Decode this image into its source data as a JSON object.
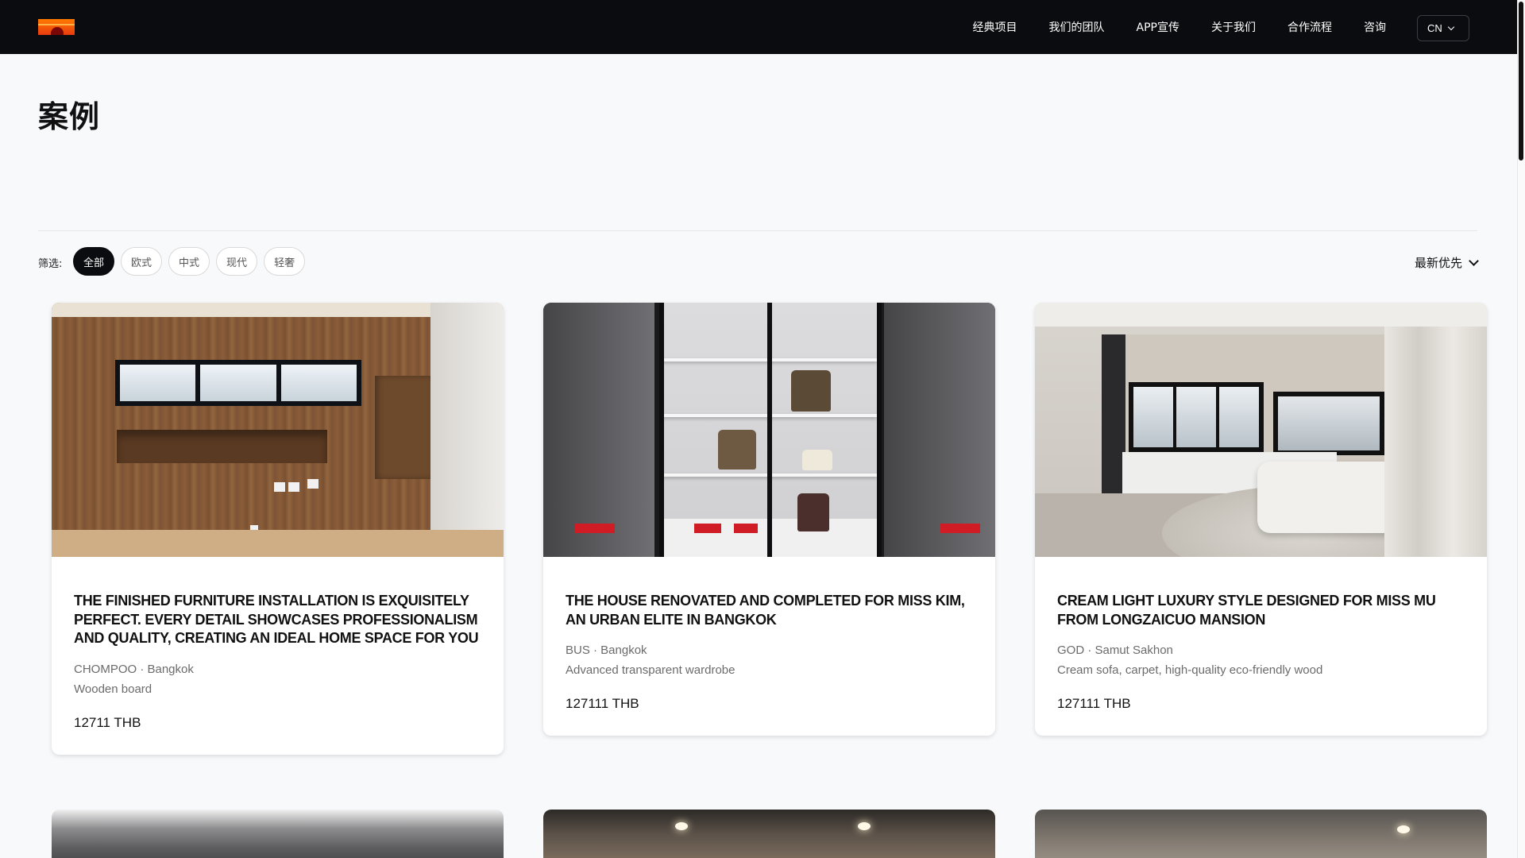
{
  "nav": {
    "links": [
      "经典项目",
      "我们的团队",
      "APP宣传",
      "关于我们",
      "合作流程",
      "咨询"
    ],
    "lang": "CN"
  },
  "page": {
    "title": "案例"
  },
  "filters": {
    "label": "筛选:",
    "chips": [
      "全部",
      "欧式",
      "中式",
      "现代",
      "轻奢"
    ],
    "active": "全部",
    "sort": "最新优先"
  },
  "cards": [
    {
      "title": "THE FINISHED FURNITURE INSTALLATION IS EXQUISITELY PERFECT. EVERY DETAIL SHOWCASES PROFESSIONALISM AND QUALITY, CREATING AN IDEAL HOME SPACE FOR YOU",
      "meta": "CHOMPOO · Bangkok",
      "material": "Wooden board",
      "price": "12711 THB"
    },
    {
      "title": "THE HOUSE RENOVATED AND COMPLETED FOR MISS KIM, AN URBAN ELITE IN BANGKOK",
      "meta": "BUS · Bangkok",
      "material": "Advanced transparent wardrobe",
      "price": "127111 THB"
    },
    {
      "title": "CREAM LIGHT LUXURY STYLE DESIGNED FOR MISS MU FROM LONGZAICUO MANSION",
      "meta": "GOD · Samut Sakhon",
      "material": "Cream sofa, carpet, high-quality eco-friendly wood",
      "price": "127111 THB"
    }
  ]
}
